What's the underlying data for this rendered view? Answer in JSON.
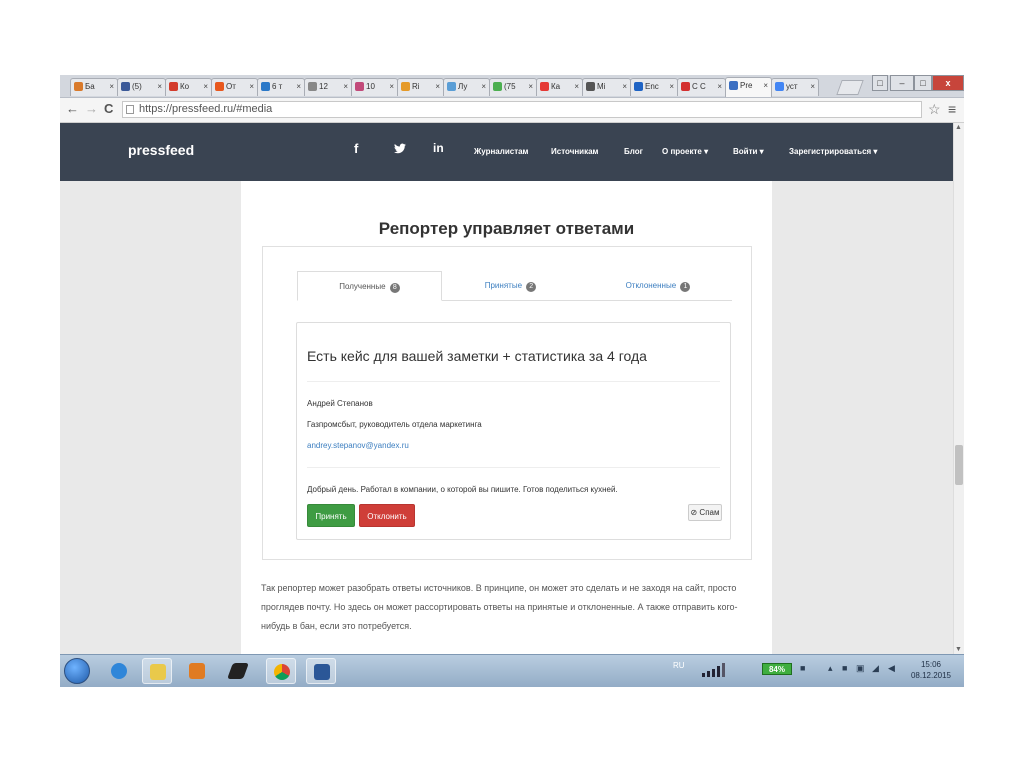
{
  "browser": {
    "tabs": [
      {
        "label": "Ба",
        "color": "#d97a2b"
      },
      {
        "label": "(5)",
        "color": "#3b5998"
      },
      {
        "label": "Ко",
        "color": "#d33b2c"
      },
      {
        "label": "От",
        "color": "#e8581e"
      },
      {
        "label": "6 т",
        "color": "#2a78c8"
      },
      {
        "label": "12",
        "color": "#888888"
      },
      {
        "label": "10",
        "color": "#c24a7a"
      },
      {
        "label": "Ri",
        "color": "#e59a29"
      },
      {
        "label": "Лу",
        "color": "#5a9ed6"
      },
      {
        "label": "(75",
        "color": "#4caf50"
      },
      {
        "label": "Ка",
        "color": "#e53935"
      },
      {
        "label": "Mi",
        "color": "#555555"
      },
      {
        "label": "Enc",
        "color": "#1e63c4"
      },
      {
        "label": "C C",
        "color": "#d32f2f"
      },
      {
        "label": "Pre",
        "color": "#3b6fc2",
        "active": true
      },
      {
        "label": "уст",
        "color": "#4285f4"
      }
    ],
    "tab_close": "×",
    "address": "https://pressfeed.ru/#media",
    "back": "←",
    "forward": "→",
    "reload": "C",
    "star": "☆",
    "menu": "≡",
    "win_min": "–",
    "win_max": "□",
    "win_close": "x"
  },
  "site": {
    "logo": "pressfeed",
    "social": {
      "facebook": "f",
      "twitter": "🐦",
      "linkedin": "in"
    },
    "nav": {
      "journalists": "Журналистам",
      "sources": "Источникам",
      "blog": "Блог",
      "about": "О проекте ▾",
      "login": "Войти ▾",
      "register": "Зарегистрироваться ▾"
    }
  },
  "page": {
    "heading": "Репортер управляет ответами",
    "tabs": [
      {
        "label": "Полученные",
        "count": "8"
      },
      {
        "label": "Принятые",
        "count": "2"
      },
      {
        "label": "Отклоненные",
        "count": "1"
      }
    ],
    "answer": {
      "title": "Есть кейс для вашей заметки + статистика за 4 года",
      "name": "Андрей Степанов",
      "company": "Газпромсбыт, руководитель отдела маркетинга",
      "email": "andrey.stepanov@yandex.ru",
      "message": "Добрый день. Работал в компании, о которой вы пишите. Готов поделиться кухней.",
      "accept": "Принять",
      "reject": "Отклонить",
      "spam": "⊘ Спам"
    },
    "paragraph": "Так репортер может разобрать ответы источников. В принципе, он может это сделать и не заходя на сайт, просто проглядев почту. Но здесь он может рассортировать ответы на принятые и отклоненные. А также отправить кого-нибудь в бан, если это потребуется."
  },
  "taskbar": {
    "lang": "RU",
    "battery": "84%",
    "time": "15:06",
    "date": "08.12.2015"
  }
}
